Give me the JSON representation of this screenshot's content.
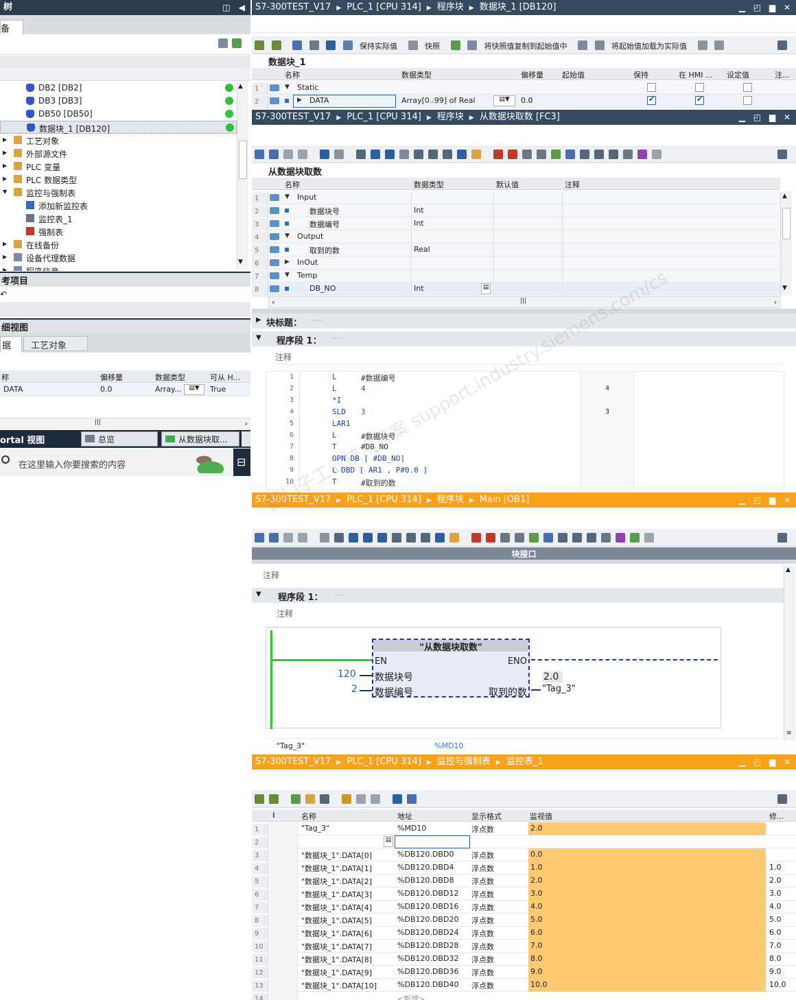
{
  "left_panel": {
    "title": "树",
    "tab": "备",
    "tree_items": [
      {
        "label": "DB2 [DB2]"
      },
      {
        "label": "DB3 [DB3]"
      },
      {
        "label": "DB50 [DB50]"
      },
      {
        "label": "数据块_1 [DB120]"
      },
      {
        "label": "工艺对象"
      },
      {
        "label": "外部源文件"
      },
      {
        "label": "PLC 变量"
      },
      {
        "label": "PLC 数据类型"
      },
      {
        "label": "监控与强制表"
      },
      {
        "label": "添加新监控表"
      },
      {
        "label": "监控表_1"
      },
      {
        "label": "强制表"
      },
      {
        "label": "在线备份"
      },
      {
        "label": "设备代理数据"
      },
      {
        "label": "程序信息"
      }
    ],
    "ref_title": "考项目",
    "detail_title": "细视图",
    "detail_tabs": [
      "据",
      "工艺对象"
    ],
    "detail_headers": [
      "称",
      "偏移量",
      "数据类型",
      "可从 H..."
    ],
    "detail_row": {
      "name": "DATA",
      "offset": "0.0",
      "type": "Array...",
      "hmi": "True"
    },
    "portal_label": "ortal 视图",
    "taskbar_items": [
      "总览",
      "从数据块取..."
    ],
    "search_placeholder": "在这里输入你要搜索的内容"
  },
  "db_window": {
    "breadcrumb": [
      "S7-300TEST_V17",
      "PLC_1 [CPU 314]",
      "程序块",
      "数据块_1 [DB120]"
    ],
    "toolbar_labels": [
      "保持实际值",
      "快照",
      "将快照值复制到起始值中",
      "将起始值加载为实际值"
    ],
    "block_name": "数据块_1",
    "headers": [
      "名称",
      "数据类型",
      "偏移量",
      "起始值",
      "保持",
      "在 HMI ...",
      "设定值",
      "注..."
    ],
    "rows": [
      {
        "n": "1",
        "name": "Static",
        "type": "",
        "offset": "",
        "start": "",
        "retain": false,
        "hmi": false,
        "setpoint": false
      },
      {
        "n": "2",
        "name": "DATA",
        "type": "Array[0..99] of Real",
        "offset": "0.0",
        "start": "",
        "retain": true,
        "hmi": true,
        "setpoint": false
      }
    ]
  },
  "fc_window": {
    "breadcrumb": [
      "S7-300TEST_V17",
      "PLC_1 [CPU 314]",
      "程序块",
      "从数据块取数 [FC3]"
    ],
    "block_name": "从数据块取数",
    "headers": [
      "名称",
      "数据类型",
      "默认值",
      "注释"
    ],
    "rows": [
      {
        "n": "1",
        "name": "Input",
        "type": "",
        "indent": 0
      },
      {
        "n": "2",
        "name": "数据块号",
        "type": "Int",
        "indent": 1
      },
      {
        "n": "3",
        "name": "数据编号",
        "type": "Int",
        "indent": 1
      },
      {
        "n": "4",
        "name": "Output",
        "type": "",
        "indent": 0
      },
      {
        "n": "5",
        "name": "取到的数",
        "type": "Real",
        "indent": 1
      },
      {
        "n": "6",
        "name": "InOut",
        "type": "",
        "indent": 0
      },
      {
        "n": "7",
        "name": "Temp",
        "type": "",
        "indent": 0
      },
      {
        "n": "8",
        "name": "DB_NO",
        "type": "Int",
        "indent": 1
      }
    ],
    "block_title": "块标题：",
    "network_title": "程序段 1：",
    "comment": "注释",
    "code": [
      {
        "n": "1",
        "op": "L",
        "arg": "#数据编号",
        "val": ""
      },
      {
        "n": "2",
        "op": "L",
        "arg": "4",
        "val": "4"
      },
      {
        "n": "3",
        "op": "*I",
        "arg": "",
        "val": ""
      },
      {
        "n": "4",
        "op": "SLD",
        "arg": "3",
        "val": "3"
      },
      {
        "n": "5",
        "op": "LAR1",
        "arg": "",
        "val": ""
      },
      {
        "n": "6",
        "op": "L",
        "arg": "#数据块号",
        "val": ""
      },
      {
        "n": "7",
        "op": "T",
        "arg": "#DB_NO",
        "val": ""
      },
      {
        "n": "8",
        "op": "OPN DB [ #DB_NO]",
        "arg": "",
        "val": ""
      },
      {
        "n": "9",
        "op": "L DBD [ AR1 , P#0.0 ]",
        "arg": "",
        "val": ""
      },
      {
        "n": "10",
        "op": "T",
        "arg": "#取到的数",
        "val": ""
      }
    ]
  },
  "ob_window": {
    "breadcrumb": [
      "S7-300TEST_V17",
      "PLC_1 [CPU 314]",
      "程序块",
      "Main [OB1]"
    ],
    "interface_label": "块接口",
    "comment": "注释",
    "network_title": "程序段 1：",
    "fb_title": "\"从数据块取数\"",
    "en": "EN",
    "eno": "ENO",
    "in1_label": "数据块号",
    "in1_val": "120",
    "in2_label": "数据编号",
    "in2_val": "2",
    "out_label": "取到的数",
    "out_val": "2.0",
    "out_tag": "\"Tag_3\"",
    "info_tag": "\"Tag_3\"",
    "info_addr": "%MD10"
  },
  "watch_window": {
    "breadcrumb": [
      "S7-300TEST_V17",
      "PLC_1 [CPU 314]",
      "监控与强制表",
      "监控表_1"
    ],
    "headers": [
      "i",
      "名称",
      "地址",
      "显示格式",
      "监视值",
      "修..."
    ],
    "rows": [
      {
        "n": "1",
        "name": "\"Tag_3\"",
        "addr": "%MD10",
        "fmt": "浮点数",
        "val": "2.0",
        "mod": ""
      },
      {
        "n": "2",
        "name": "",
        "addr": "",
        "fmt": "",
        "val": "",
        "mod": ""
      },
      {
        "n": "3",
        "name": "\"数据块_1\".DATA[0]",
        "addr": "%DB120.DBD0",
        "fmt": "浮点数",
        "val": "0.0",
        "mod": ""
      },
      {
        "n": "4",
        "name": "\"数据块_1\".DATA[1]",
        "addr": "%DB120.DBD4",
        "fmt": "浮点数",
        "val": "1.0",
        "mod": "1.0"
      },
      {
        "n": "5",
        "name": "\"数据块_1\".DATA[2]",
        "addr": "%DB120.DBD8",
        "fmt": "浮点数",
        "val": "2.0",
        "mod": "2.0"
      },
      {
        "n": "6",
        "name": "\"数据块_1\".DATA[3]",
        "addr": "%DB120.DBD12",
        "fmt": "浮点数",
        "val": "3.0",
        "mod": "3.0"
      },
      {
        "n": "7",
        "name": "\"数据块_1\".DATA[4]",
        "addr": "%DB120.DBD16",
        "fmt": "浮点数",
        "val": "4.0",
        "mod": "4.0"
      },
      {
        "n": "8",
        "name": "\"数据块_1\".DATA[5]",
        "addr": "%DB120.DBD20",
        "fmt": "浮点数",
        "val": "5.0",
        "mod": "5.0"
      },
      {
        "n": "9",
        "name": "\"数据块_1\".DATA[6]",
        "addr": "%DB120.DBD24",
        "fmt": "浮点数",
        "val": "6.0",
        "mod": "6.0"
      },
      {
        "n": "10",
        "name": "\"数据块_1\".DATA[7]",
        "addr": "%DB120.DBD28",
        "fmt": "浮点数",
        "val": "7.0",
        "mod": "7.0"
      },
      {
        "n": "11",
        "name": "\"数据块_1\".DATA[8]",
        "addr": "%DB120.DBD32",
        "fmt": "浮点数",
        "val": "8.0",
        "mod": "8.0"
      },
      {
        "n": "12",
        "name": "\"数据块_1\".DATA[9]",
        "addr": "%DB120.DBD36",
        "fmt": "浮点数",
        "val": "9.0",
        "mod": "9.0"
      },
      {
        "n": "13",
        "name": "\"数据块_1\".DATA[10]",
        "addr": "%DB120.DBD40",
        "fmt": "浮点数",
        "val": "10.0",
        "mod": "10.0"
      },
      {
        "n": "14",
        "name": "",
        "addr": "<新增>",
        "fmt": "",
        "val": "",
        "mod": ""
      }
    ]
  },
  "watermark": "西门子工业技术答案 support.industry.siemens.com/cs"
}
